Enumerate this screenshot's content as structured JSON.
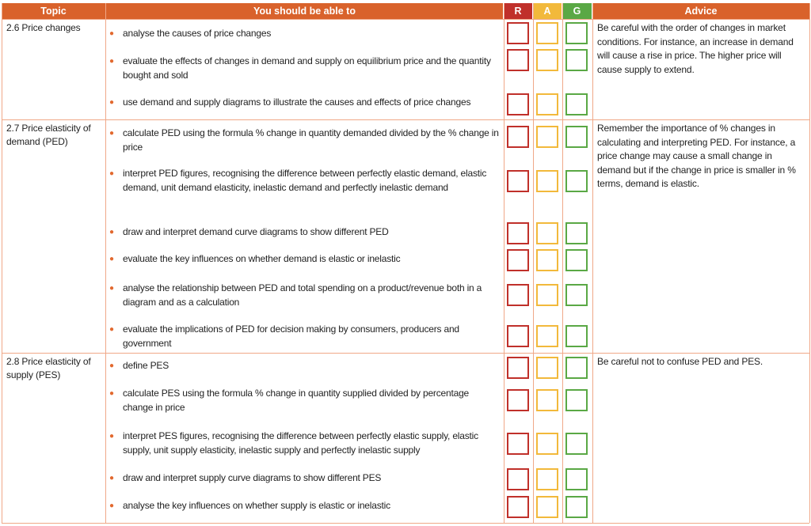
{
  "colors": {
    "header": "#d9622b",
    "red": "#c0302a",
    "amber": "#f2b93b",
    "green": "#5aa845",
    "border": "#f0a888",
    "bullet": "#e2692f"
  },
  "header": {
    "topic": "Topic",
    "objectives": "You should be able to",
    "r": "R",
    "a": "A",
    "g": "G",
    "advice": "Advice"
  },
  "sections": [
    {
      "topic": "2.6 Price changes",
      "advice": "Be careful with the order of changes in market conditions. For instance, an increase in demand will cause a rise in price. The higher price will cause supply to extend.",
      "items": [
        "analyse the causes of price changes",
        "evaluate the effects of changes in demand and supply on equilibrium price and the quantity bought and sold",
        "use demand and supply diagrams to illustrate the causes and effects of price changes"
      ]
    },
    {
      "topic": "2.7 Price elasticity of demand (PED)",
      "advice": "Remember the importance of % changes in calculating and interpreting PED. For instance, a price change may cause a small change in demand but if the change in price is smaller in % terms, demand is elastic.",
      "items": [
        "calculate PED using the formula % change in quantity demanded divided by the % change in price",
        "interpret PED figures, recognising the difference between perfectly elastic demand, elastic demand, unit demand elasticity, inelastic demand and perfectly inelastic demand",
        "draw and interpret demand curve diagrams to show different PED",
        "evaluate the key influences on whether demand is elastic or inelastic",
        "analyse the relationship between PED and total spending on a product/revenue both in a diagram and as a calculation",
        "evaluate the implications of PED for decision making by consumers, producers and government"
      ]
    },
    {
      "topic": "2.8 Price elasticity of supply (PES)",
      "advice": "Be careful not to confuse PED and PES.",
      "items": [
        "define PES",
        "calculate PES using the formula % change in quantity supplied divided by percentage change in price",
        "interpret PES figures, recognising the difference between perfectly elastic supply, elastic supply, unit supply elasticity, inelastic supply and perfectly inelastic supply",
        "draw and interpret supply curve diagrams to show different PES",
        "analyse the key influences on whether supply is elastic or inelastic"
      ]
    }
  ]
}
